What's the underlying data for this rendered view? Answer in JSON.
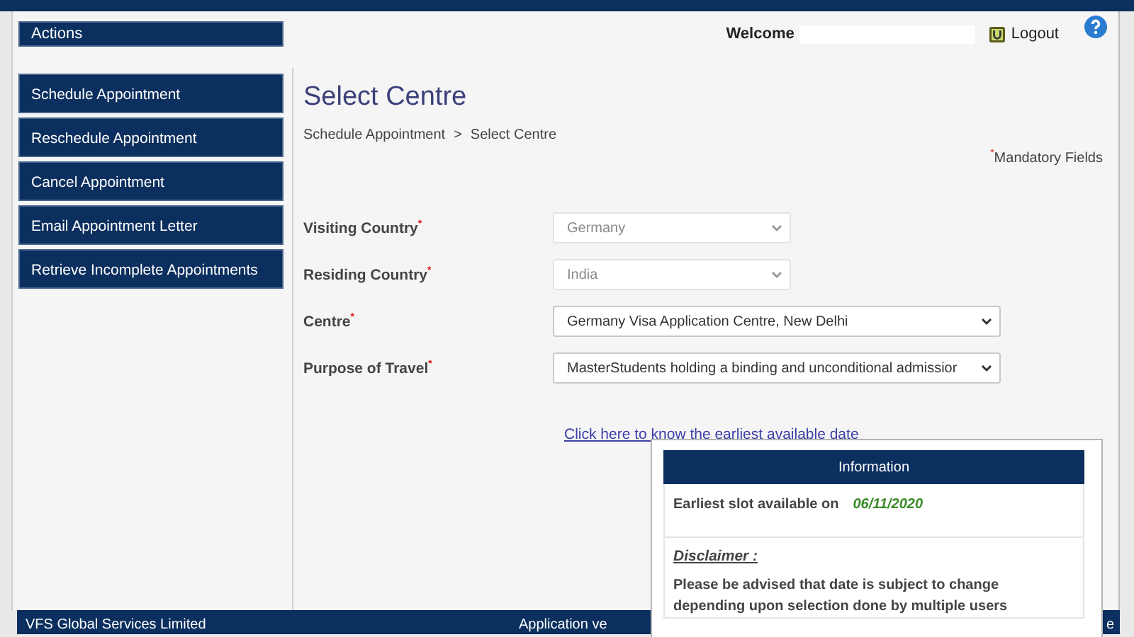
{
  "actions_header": "Actions",
  "user_bar": {
    "welcome_label": "Welcome",
    "logout": "Logout"
  },
  "sidebar": {
    "items": [
      {
        "label": "Schedule Appointment"
      },
      {
        "label": "Reschedule Appointment"
      },
      {
        "label": "Cancel Appointment"
      },
      {
        "label": "Email Appointment Letter"
      },
      {
        "label": "Retrieve Incomplete Appointments"
      }
    ]
  },
  "page_title": "Select Centre",
  "breadcrumb": [
    "Schedule Appointment",
    "Select Centre"
  ],
  "breadcrumb_separator": ">",
  "mandatory_note": {
    "mark": "*",
    "text": "Mandatory Fields"
  },
  "form": {
    "fields": [
      {
        "label": "Visiting Country",
        "required": true,
        "value": "Germany",
        "disabled": true,
        "wide": false
      },
      {
        "label": "Residing Country",
        "required": true,
        "value": "India",
        "disabled": true,
        "wide": false
      },
      {
        "label": "Centre",
        "required": true,
        "value": "Germany Visa Application Centre, New Delhi",
        "disabled": false,
        "wide": true
      },
      {
        "label": "Purpose of Travel",
        "required": true,
        "value": "MasterStudents holding a binding and unconditional admissior",
        "disabled": false,
        "wide": true
      }
    ]
  },
  "earliest_date_link": "Click here to know the earliest available date",
  "info_popup": {
    "title": "Information",
    "slot_label": "Earliest slot available on",
    "slot_date": "06/11/2020",
    "disclaimer_title": "Disclaimer :",
    "disclaimer_text": "Please be advised that date is subject to change depending upon selection done by multiple users"
  },
  "footer": {
    "company": "VFS Global Services Limited",
    "version": "Application ve",
    "right_edge": "e"
  }
}
